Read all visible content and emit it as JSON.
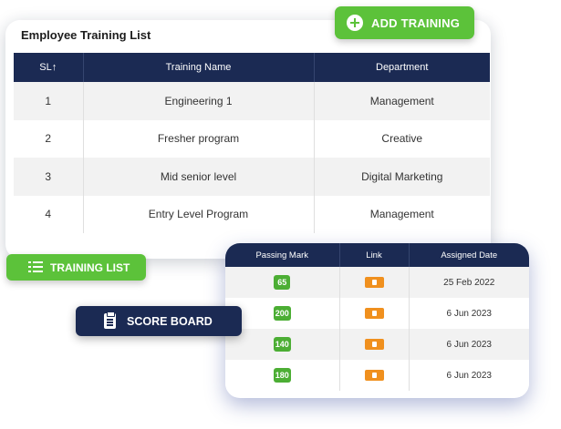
{
  "main_card": {
    "title": "Employee Training List",
    "columns": [
      "SL↑",
      "Training Name",
      "Department"
    ],
    "rows": [
      {
        "sl": "1",
        "name": "Engineering 1",
        "department": "Management"
      },
      {
        "sl": "2",
        "name": "Fresher program",
        "department": "Creative"
      },
      {
        "sl": "3",
        "name": "Mid senior level",
        "department": "Digital Marketing"
      },
      {
        "sl": "4",
        "name": "Entry Level Program",
        "department": "Management"
      }
    ]
  },
  "buttons": {
    "add_training": "ADD TRAINING",
    "training_list": "TRAINING LIST",
    "score_board": "SCORE BOARD"
  },
  "score_card": {
    "columns": [
      "Passing Mark",
      "Link",
      "Assigned Date"
    ],
    "rows": [
      {
        "mark": "65",
        "date": "25 Feb 2022"
      },
      {
        "mark": "200",
        "date": "6 Jun 2023"
      },
      {
        "mark": "140",
        "date": "6 Jun 2023"
      },
      {
        "mark": "180",
        "date": "6 Jun 2023"
      }
    ]
  },
  "colors": {
    "navy": "#1b2a53",
    "green": "#5cc23a",
    "orange": "#f0901e"
  },
  "icons": {
    "add_training": "plus-circle-icon",
    "training_list": "list-icon",
    "score_board": "clipboard-icon",
    "link": "document-icon"
  }
}
